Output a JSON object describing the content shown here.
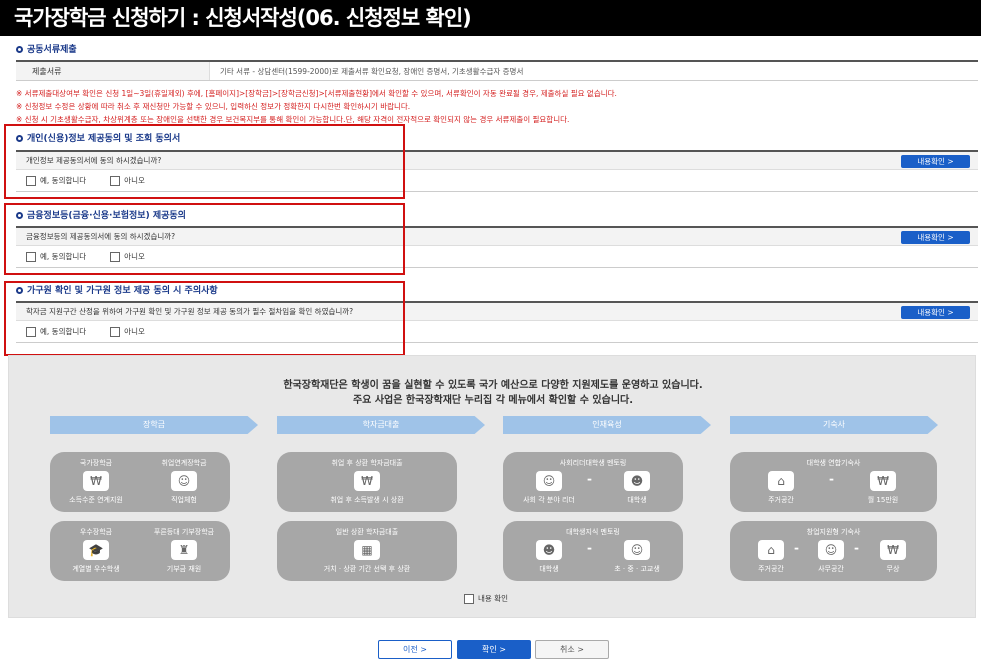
{
  "header": {
    "title": "국가장학금 신청하기 : 신청서작성(06. 신청정보 확인)"
  },
  "docs": {
    "section": "공동서류제출",
    "th": "제출서류",
    "td": "기타 서류 - 상담센터(1599-2000)로 제출서류 확인요청, 장애인 증명서, 기초생활수급자 증명서"
  },
  "notes": [
    "※ 서류제출대상여부 확인은 신청 1일~3일(휴일제외) 후에, [홈페이지]>[장학금]>[장학금신청]>[서류제출현황]에서 확인할 수 있으며, 서류확인이 자동 완료될 경우, 제출하실 필요 없습니다.",
    "※ 신청정보 수정은 상황에 따라 취소 후 재신청만 가능할 수 있으니, 입력하신 정보가 정확한지 다시한번 확인하시기 바랍니다.",
    "※ 신청 시 기초생활수급자, 차상위계층 또는 장애인을 선택한 경우 보건복지부를 통해 확인이 가능합니다.단, 해당 자격이 전자적으로 확인되지 않는 경우 서류제출이 필요합니다."
  ],
  "agreements": [
    {
      "title": "개인(신용)정보 제공동의 및 조회 동의서",
      "question": "개인정보 제공동의서에 동의 하시겠습니까?",
      "yes": "예, 동의합니다",
      "no": "아니오",
      "button": "내용확인 >"
    },
    {
      "title": "금융정보등(금융·신용·보험정보) 제공동의",
      "question": "금융정보등의 제공동의서에 동의 하시겠습니까?",
      "yes": "예, 동의합니다",
      "no": "아니오",
      "button": "내용확인 >"
    },
    {
      "title": "가구원 확인 및 가구원 정보 제공 동의 시 주의사항",
      "question": "학자금 지원구간 산정을 위하여 가구원 확인 및 가구원 정보 제공 동의가 필수 절차임을 확인 하였습니까?",
      "yes": "예, 동의합니다",
      "no": "아니오",
      "button": "내용확인 >"
    }
  ],
  "info": {
    "line1": "한국장학재단은 학생이 꿈을 실현할 수 있도록 국가 예산으로 다양한 지원제도를 운영하고 있습니다.",
    "line2": "주요 사업은 한국장학재단 누리집 각 메뉴에서 확인할 수 있습니다.",
    "categories": [
      "장학금",
      "학자금대출",
      "인재육성",
      "기숙사"
    ],
    "cards": {
      "a1": {
        "t1": "국가장학금",
        "t2": "취업연계장학금",
        "b1": "소득수준 연계지원",
        "b2": "직업체험"
      },
      "a2": {
        "t1": "우수장학금",
        "t2": "푸른등대 기부장학금",
        "b1": "계열별 우수학생",
        "b2": "기부금 재원"
      },
      "b1": {
        "t": "취업 후 상환 학자금대출",
        "b": "취업 후 소득발생 시 상환"
      },
      "b2": {
        "t": "일반 상환 학자금대출",
        "b": "거치 · 상환 기간 선택 후 상환"
      },
      "c1": {
        "t": "사회리더대학생 멘토링",
        "b1": "사회 각 분야 리더",
        "b2": "대학생"
      },
      "c2": {
        "t": "대학생지식 멘토링",
        "b1": "대학생",
        "b2": "초 · 중 · 고교생"
      },
      "d1": {
        "t": "대학생 연합기숙사",
        "b1": "주거공간",
        "b2": "월 15만원"
      },
      "d2": {
        "t": "창업지원형 기숙사",
        "b1": "주거공간",
        "b2": "사무공간",
        "b3": "무상"
      }
    },
    "confirm": "내용 확인"
  },
  "buttons": {
    "prev": "이전 >",
    "confirm": "확인 >",
    "cancel": "취소 >"
  }
}
